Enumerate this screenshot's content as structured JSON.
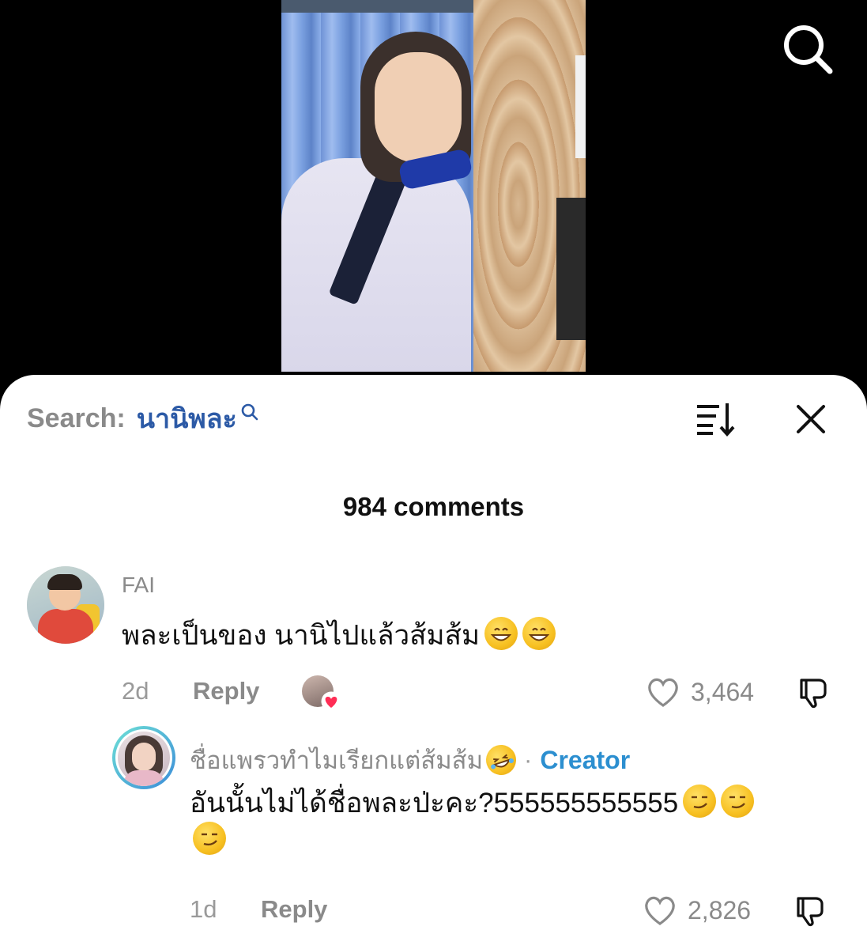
{
  "search_panel": {
    "prefix": "Search:",
    "term": "นานิพละ"
  },
  "icons": {
    "top_search": "search-icon",
    "sort": "sort-icon",
    "close": "close-icon",
    "like": "heart-icon",
    "dislike": "dislike-icon"
  },
  "colors": {
    "search_term": "#2c5aa6",
    "creator_badge": "#2c8fd0",
    "creator_heart": "#ff2d55"
  },
  "comments_header": {
    "count_label": "984 comments"
  },
  "comments": [
    {
      "username": "FAI",
      "text": "พละเป็นของ นานิไปแล้วส้มส้ม",
      "time": "2d",
      "reply_label": "Reply",
      "likes": "3,464",
      "liked_by_creator": true
    }
  ],
  "reply": {
    "username": "ชื่อแพรวทำไมเรียกแต่ส้มส้ม",
    "separator": "·",
    "badge": "Creator",
    "text": "อันนั้นไม่ได้ชื่อพละป่ะคะ?555555555555",
    "time": "1d",
    "reply_label": "Reply",
    "likes": "2,826"
  }
}
